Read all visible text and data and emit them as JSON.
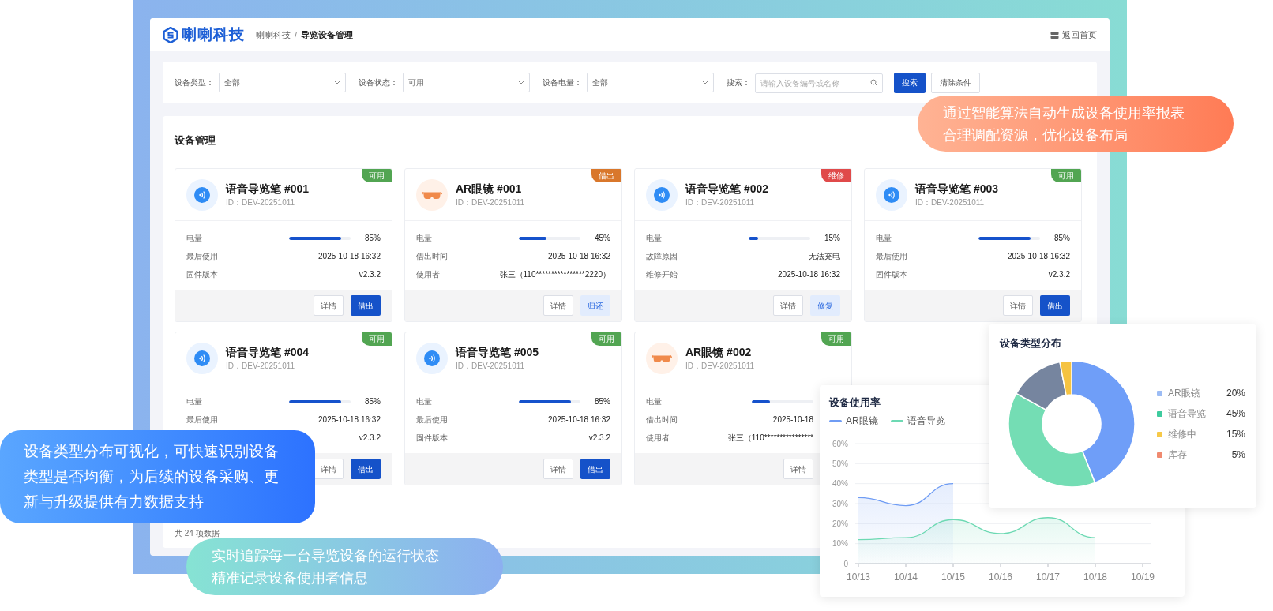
{
  "header": {
    "logo": "喇喇科技",
    "breadcrumb": [
      {
        "label": "喇喇科技",
        "current": false
      },
      {
        "label": "导览设备管理",
        "current": true
      }
    ],
    "separator": "/",
    "home_link": "返回首页"
  },
  "filters": [
    {
      "label": "设备类型：",
      "value": "全部",
      "kind": "select"
    },
    {
      "label": "设备状态：",
      "value": "可用",
      "kind": "select"
    },
    {
      "label": "设备电量：",
      "value": "全部",
      "kind": "select"
    },
    {
      "label": "搜索：",
      "placeholder": "请输入设备编号或名称",
      "kind": "search"
    }
  ],
  "filter_buttons": [
    {
      "label": "搜索",
      "kind": "primary"
    },
    {
      "label": "清除条件",
      "kind": "default"
    }
  ],
  "section_title": "设备管理",
  "devices": [
    {
      "title": "语音导览笔 #001",
      "id": "ID：DEV-20251011",
      "kind": "pen",
      "badge": {
        "text": "可用",
        "color": "#52a552"
      },
      "rows": [
        {
          "label": "电量",
          "level": 0.85,
          "value": "85%"
        },
        {
          "label": "最后使用",
          "value": "2025-10-18 16:32"
        },
        {
          "label": "固件版本",
          "value": "v2.3.2"
        }
      ],
      "buttons": [
        {
          "label": "详情",
          "kind": "default"
        },
        {
          "label": "借出",
          "kind": "primary"
        }
      ]
    },
    {
      "title": "AR眼镜 #001",
      "id": "ID：DEV-20251011",
      "kind": "glasses",
      "badge": {
        "text": "借出",
        "color": "#d9772b"
      },
      "rows": [
        {
          "label": "电量",
          "level": 0.45,
          "value": "45%"
        },
        {
          "label": "借出时间",
          "value": "2025-10-18 16:32"
        },
        {
          "label": "使用者",
          "value": "张三（110****************2220）"
        }
      ],
      "buttons": [
        {
          "label": "详情",
          "kind": "default"
        },
        {
          "label": "归还",
          "kind": "light"
        }
      ]
    },
    {
      "title": "语音导览笔 #002",
      "id": "ID：DEV-20251011",
      "kind": "pen",
      "badge": {
        "text": "维修",
        "color": "#e04a4a"
      },
      "rows": [
        {
          "label": "电量",
          "level": 0.15,
          "value": "15%"
        },
        {
          "label": "故障原因",
          "value": "无法充电"
        },
        {
          "label": "维修开始",
          "value": "2025-10-18 16:32"
        }
      ],
      "buttons": [
        {
          "label": "详情",
          "kind": "default"
        },
        {
          "label": "修复",
          "kind": "light"
        }
      ]
    },
    {
      "title": "语音导览笔 #003",
      "id": "ID：DEV-20251011",
      "kind": "pen",
      "badge": {
        "text": "可用",
        "color": "#52a552"
      },
      "rows": [
        {
          "label": "电量",
          "level": 0.85,
          "value": "85%"
        },
        {
          "label": "最后使用",
          "value": "2025-10-18 16:32"
        },
        {
          "label": "固件版本",
          "value": "v2.3.2"
        }
      ],
      "buttons": [
        {
          "label": "详情",
          "kind": "default"
        },
        {
          "label": "借出",
          "kind": "primary"
        }
      ]
    },
    {
      "title": "语音导览笔 #004",
      "id": "ID：DEV-20251011",
      "kind": "pen",
      "badge": {
        "text": "可用",
        "color": "#52a552"
      },
      "rows": [
        {
          "label": "电量",
          "level": 0.85,
          "value": "85%"
        },
        {
          "label": "最后使用",
          "value": "2025-10-18 16:32"
        },
        {
          "value": "v2.3.2"
        }
      ],
      "buttons": [
        {
          "label": "详情",
          "kind": "default"
        },
        {
          "label": "借出",
          "kind": "primary"
        }
      ]
    },
    {
      "title": "语音导览笔 #005",
      "id": "ID：DEV-20251011",
      "kind": "pen",
      "badge": {
        "text": "可用",
        "color": "#52a552"
      },
      "rows": [
        {
          "label": "电量",
          "level": 0.85,
          "value": "85%"
        },
        {
          "label": "最后使用",
          "value": "2025-10-18 16:32"
        },
        {
          "label": "固件版本",
          "value": "v2.3.2"
        }
      ],
      "buttons": [
        {
          "label": "详情",
          "kind": "default"
        },
        {
          "label": "借出",
          "kind": "primary"
        }
      ]
    },
    {
      "title": "AR眼镜 #002",
      "id": "ID：DEV-20251011",
      "kind": "glasses",
      "badge": {
        "text": "可用",
        "color": "#52a552"
      },
      "rows": [
        {
          "label": "电量",
          "level": 0.3
        },
        {
          "label": "借出时间",
          "value": "2025-10-18"
        },
        {
          "label": "使用者",
          "value": "张三（110****************"
        }
      ],
      "buttons": [
        {
          "label": "详情",
          "kind": "default"
        }
      ]
    }
  ],
  "total": "共 24 项数据",
  "callouts": [
    {
      "lines": [
        "通过智能算法自动生成设备使用率报表",
        "合理调配资源，优化设备布局"
      ]
    },
    {
      "lines": [
        "设备类型分布可视化，可快速识别设备",
        "类型是否均衡，为后续的设备采购、更",
        "新与升级提供有力数据支持"
      ]
    },
    {
      "lines": [
        "实时追踪每一台导览设备的运行状态",
        "精准记录设备使用者信息"
      ]
    }
  ],
  "usage_chart": {
    "chart_data": {
      "type": "area",
      "grid": true,
      "title": "设备使用率",
      "categories": [
        "10/13",
        "10/14",
        "10/15",
        "10/16",
        "10/17",
        "10/18",
        "10/19"
      ],
      "series": [
        {
          "name": "AR眼镜",
          "color": "#6f9cf4",
          "values": [
            33,
            29,
            40,
            null,
            null,
            null,
            null
          ]
        },
        {
          "name": "语音导览",
          "color": "#6dd9b3",
          "values": [
            12,
            13,
            22,
            15,
            23,
            13,
            null
          ]
        }
      ],
      "ylim": [
        0,
        60
      ],
      "yticks": [
        0,
        {
          "value": 10,
          "label": "10%"
        },
        {
          "value": 20,
          "label": "20%"
        },
        {
          "value": 30,
          "label": "30%"
        },
        {
          "value": 40,
          "label": "40%"
        },
        {
          "value": 50,
          "label": "50%"
        },
        {
          "value": 60,
          "label": "60%"
        }
      ]
    }
  },
  "type_distribution": {
    "title": "设备类型分布",
    "legend": [
      {
        "label": "AR眼镜",
        "value": "20%",
        "color": "#9cbcf5"
      },
      {
        "label": "语音导览",
        "value": "45%",
        "color": "#3ecb9e"
      },
      {
        "label": "维修中",
        "value": "15%",
        "color": "#f7c948"
      },
      {
        "label": "库存",
        "value": "5%",
        "color": "#f08a70"
      }
    ]
  }
}
